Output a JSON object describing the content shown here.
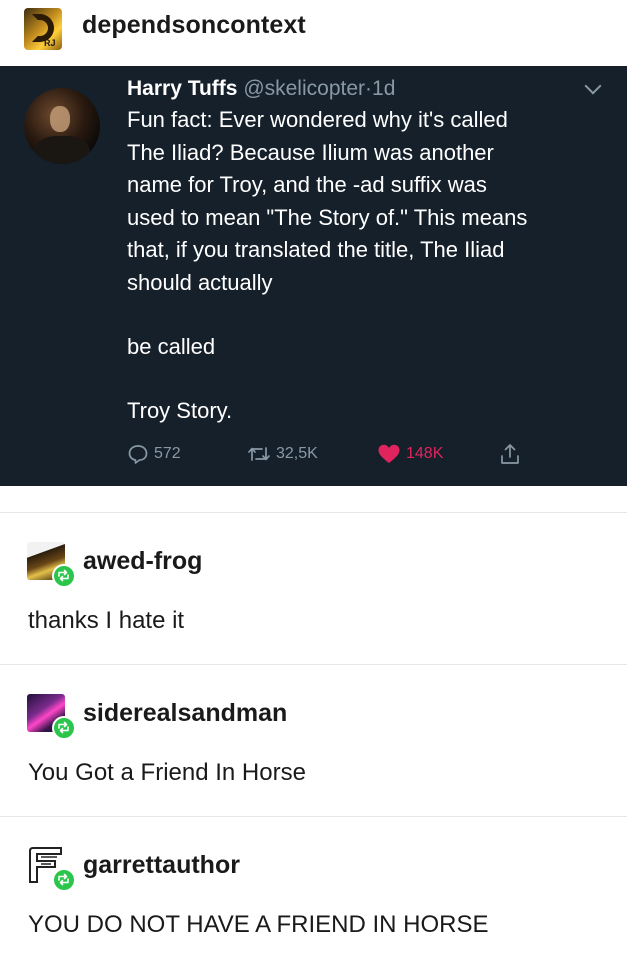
{
  "top_post": {
    "username": "dependsoncontext",
    "avatar_icon": "folded-arrow-avatar-icon",
    "avatar_mini_text": "RJ"
  },
  "tweet": {
    "author_name": "Harry Tuffs",
    "author_handle": "@skelicopter",
    "separator": "·",
    "time": "1d",
    "body_lines": [
      "Fun fact: Ever wondered why it's called",
      "The Iliad? Because Ilium was another",
      "name for Troy, and the -ad suffix was",
      "used to mean \"The Story of.\" This means",
      "that, if you translated the title, The Iliad",
      "should actually"
    ],
    "line_two": "be called",
    "line_three": "Troy Story.",
    "replies": "572",
    "retweets": "32,5K",
    "likes": "148K",
    "colors": {
      "background": "#15202b",
      "muted": "#8899a6",
      "like": "#e0245e"
    }
  },
  "replies": [
    {
      "username": "awed-frog",
      "text": "thanks I hate it",
      "avatar": "frog-avatar"
    },
    {
      "username": "siderealsandman",
      "text": "You Got a Friend In Horse",
      "avatar": "sidereal-avatar"
    },
    {
      "username": "garrettauthor",
      "text": "YOU DO NOT HAVE A FRIEND IN HORSE",
      "avatar": "garrett-avatar"
    }
  ],
  "reblog_icon": "reblog-icon",
  "reblog_color": "#2bc54b"
}
